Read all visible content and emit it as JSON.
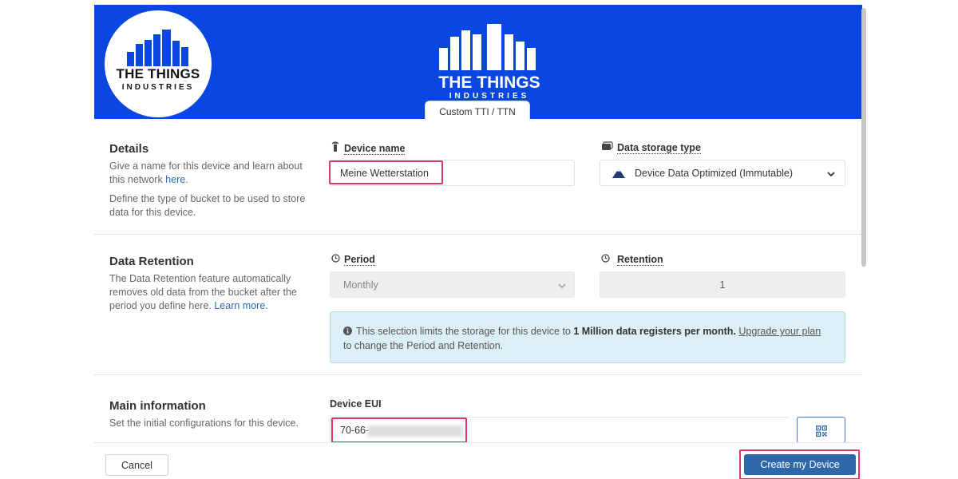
{
  "brand": {
    "badge_title": "THE THINGS",
    "badge_subtitle": "INDUSTRIES",
    "center_title": "THE THINGS",
    "center_subtitle": "INDUSTRIES",
    "tab_label": "Custom TTI / TTN",
    "header_color": "#0a47e0"
  },
  "details": {
    "title": "Details",
    "desc1_text": "Give a name for this device and learn about this network ",
    "desc1_link": "here",
    "desc1_end": ".",
    "desc2": "Define the type of bucket to be used to store data for this device.",
    "device_name_label": "Device name",
    "device_name_icon": "device-icon",
    "device_name_value": "Meine Wetterstation",
    "storage_label": "Data storage type",
    "storage_icon": "storage-icon",
    "storage_value": "Device Data Optimized (Immutable)",
    "storage_value_icon": "mountain-icon"
  },
  "retention": {
    "title": "Data Retention",
    "desc_text": "The Data Retention feature automatically removes old data from the bucket after the period you define here. ",
    "desc_link": "Learn more",
    "desc_end": ".",
    "period_label": "Period",
    "period_value": "Monthly",
    "retention_label": "Retention",
    "retention_value": "1",
    "info_pre": "This selection limits the storage for this device to ",
    "info_bold": "1 Million data registers per month.",
    "info_link": "Upgrade your plan",
    "info_post": "to change the Period and Retention."
  },
  "main_info": {
    "title": "Main information",
    "desc": "Set the initial configurations for this device.",
    "eui_label": "Device EUI",
    "eui_value": "70-66-"
  },
  "footer": {
    "cancel_label": "Cancel",
    "create_label": "Create my Device"
  },
  "colors": {
    "highlight": "#e0336a",
    "primary_button": "#2f68a8",
    "info_bg": "#dceff6"
  }
}
